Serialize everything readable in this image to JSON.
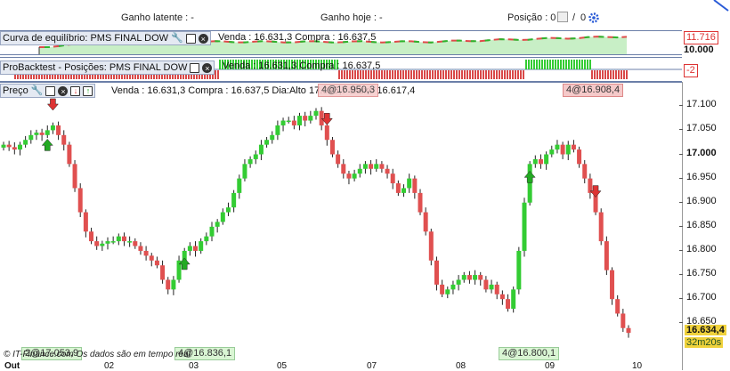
{
  "topbar": {
    "unrealized_label": "Ganho latente : -",
    "today_label": "Ganho hoje : -",
    "position_label": "Posição : 0",
    "position_sep": "/",
    "position_total": "0"
  },
  "equity_panel": {
    "title": "Curva de equilíbrio: PMS FINAL DOW",
    "info": "Venda : 16.631,3 Compra : 16.637,5",
    "value_tag": "11.716",
    "axis_value": "10.000",
    "colors": {
      "fill": "#c8efc6",
      "line_up": "#2db52d",
      "line_down": "#e04a4a"
    }
  },
  "positions_panel": {
    "title": "ProBacktest - Posições: PMS FINAL DOW",
    "info": "Venda : 16.631,3 Compra : 16.637,5",
    "value_tag": "-2",
    "colors": {
      "long": "#33cc33",
      "short": "#d94848"
    }
  },
  "price_panel": {
    "title": "Preço",
    "info": "Venda : 16.631,3 Compra : 16.637,5 Dia:Alto 17.026,7 Baixo 16.617,4",
    "overlap_tag": "4@16.950,3",
    "tag_top_right": "4@16.908,4",
    "tag_bottom_left": "2@17.053,9",
    "tag_bottom_mid": "4@16.836,1",
    "tag_bottom_right": "4@16.800,1",
    "last_price": "16.634,4",
    "countdown": "32m20s",
    "y_ticks": [
      "17.100",
      "17.050",
      "17.000",
      "16.950",
      "16.900",
      "16.850",
      "16.800",
      "16.750",
      "16.700",
      "16.650"
    ],
    "x_ticks": [
      "Out",
      "02",
      "03",
      "05",
      "07",
      "08",
      "09",
      "10"
    ],
    "watermark": "© IT-Finance.com  Os dados são em tempo real",
    "colors": {
      "up": "#33cc33",
      "down": "#e05050",
      "last_price_bg": "#f0d23c"
    }
  },
  "chart_data": {
    "type": "candlestick",
    "ylim": [
      16.61,
      17.13
    ],
    "y_ticks": [
      17.1,
      17.05,
      17.0,
      16.95,
      16.9,
      16.85,
      16.8,
      16.75,
      16.7,
      16.65
    ],
    "x_ticks": [
      "Out",
      "02",
      "03",
      "05",
      "07",
      "08",
      "09",
      "10"
    ],
    "close_series": [
      17.02,
      17.015,
      17.01,
      17.02,
      17.03,
      17.04,
      17.045,
      17.04,
      17.05,
      17.06,
      17.04,
      17.02,
      16.98,
      16.93,
      16.88,
      16.84,
      16.82,
      16.81,
      16.815,
      16.82,
      16.82,
      16.83,
      16.82,
      16.82,
      16.81,
      16.8,
      16.79,
      16.78,
      16.77,
      16.74,
      16.72,
      16.74,
      16.78,
      16.8,
      16.81,
      16.8,
      16.82,
      16.83,
      16.85,
      16.86,
      16.88,
      16.89,
      16.92,
      16.95,
      16.98,
      16.99,
      17.0,
      17.02,
      17.03,
      17.04,
      17.06,
      17.07,
      17.07,
      17.06,
      17.08,
      17.07,
      17.08,
      17.09,
      17.06,
      17.03,
      17.0,
      16.98,
      16.96,
      16.95,
      16.96,
      16.97,
      16.98,
      16.97,
      16.98,
      16.97,
      16.96,
      16.94,
      16.92,
      16.93,
      16.95,
      16.92,
      16.88,
      16.84,
      16.78,
      16.73,
      16.71,
      16.72,
      16.73,
      16.74,
      16.75,
      16.74,
      16.75,
      16.74,
      16.72,
      16.73,
      16.71,
      16.7,
      16.68,
      16.72,
      16.8,
      16.9,
      16.98,
      16.99,
      16.98,
      17.0,
      17.01,
      17.02,
      17.0,
      17.02,
      17.01,
      16.98,
      16.95,
      16.92,
      16.88,
      16.82,
      16.76,
      16.7,
      16.67,
      16.64,
      16.63
    ],
    "markers": [
      {
        "type": "sell",
        "label": "2@17.053,9"
      },
      {
        "type": "buy",
        "label": "4@16.836,1"
      },
      {
        "type": "sell",
        "label": "4@16.950,3"
      },
      {
        "type": "buy",
        "label": "4@16.800,1"
      },
      {
        "type": "sell",
        "label": "4@16.908,4"
      }
    ]
  }
}
